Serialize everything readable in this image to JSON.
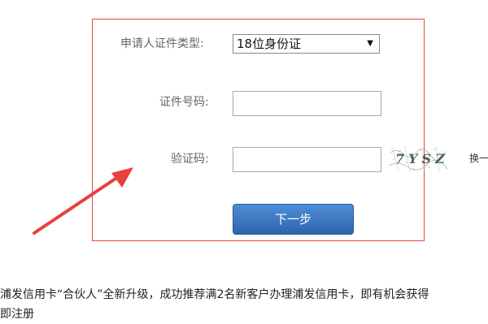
{
  "form": {
    "id_type_label": "申请人证件类型:",
    "id_type_selected": "18位身份证",
    "id_number_label": "证件号码:",
    "id_number_value": "",
    "captcha_label": "验证码:",
    "captcha_value": "",
    "captcha_text": "7YSZ",
    "captcha_refresh": "换一",
    "next_button": "下一步"
  },
  "promo": {
    "text": "浦发信用卡“合伙人”全新升级，成功推荐满2名新客户办理浦发信用卡，即有机会获得",
    "register": "即注册"
  },
  "colors": {
    "box_border": "#e0473e",
    "arrow": "#e8403a",
    "button": "#3a74c0"
  },
  "icons": {
    "select_caret": "caret-down-icon",
    "arrow": "red-arrow-annotation"
  }
}
